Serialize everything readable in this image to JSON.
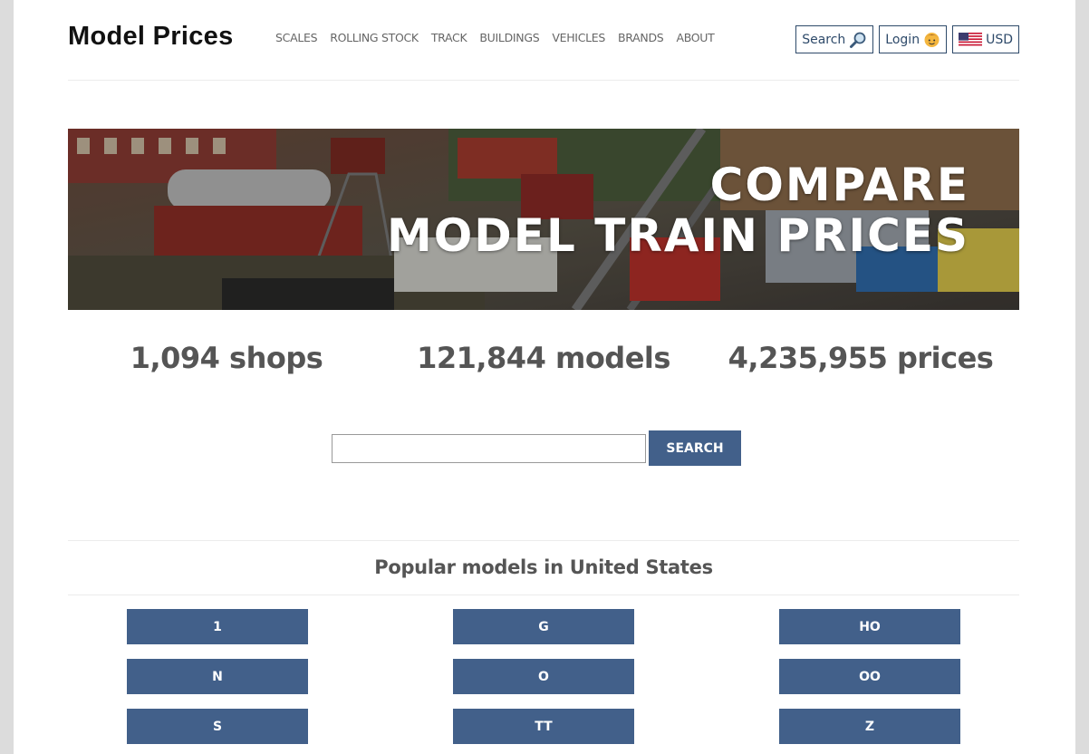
{
  "header": {
    "logo": "Model Prices",
    "nav": [
      "SCALES",
      "ROLLING STOCK",
      "TRACK",
      "BUILDINGS",
      "VEHICLES",
      "BRANDS",
      "ABOUT"
    ],
    "search_label": "Search",
    "login_label": "Login",
    "currency_label": "USD"
  },
  "hero": {
    "line1": "COMPARE",
    "line2": "MODEL TRAIN PRICES"
  },
  "stats": {
    "shops": "1,094 shops",
    "models": "121,844 models",
    "prices": "4,235,955 prices"
  },
  "search": {
    "button_label": "SEARCH",
    "placeholder": ""
  },
  "popular": {
    "title": "Popular models in United States",
    "scales": [
      "1",
      "G",
      "HO",
      "N",
      "O",
      "OO",
      "S",
      "TT",
      "Z"
    ]
  },
  "colors": {
    "button_bg": "#42608a",
    "header_border": "#2e4a6a"
  }
}
